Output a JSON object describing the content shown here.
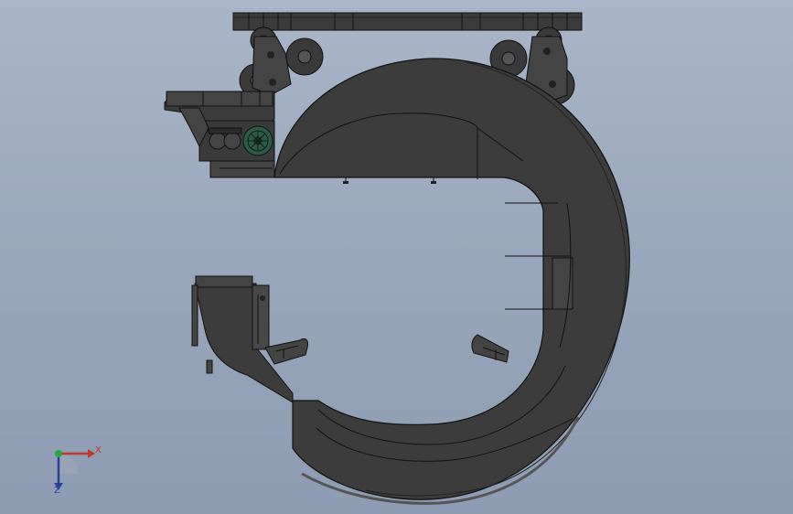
{
  "viewport": {
    "background_top": "#aab5c8",
    "background_bottom": "#8e9cb3"
  },
  "model": {
    "shade_color": "#3a3a3a",
    "edge_color": "#151515",
    "highlight_color": "#4a4a4a",
    "motor_color": "#2f5a48"
  },
  "triad": {
    "x_label": "X",
    "z_label": "Z",
    "x_color": "#c0392b",
    "z_color": "#2c3e9c",
    "y_color": "#27a844"
  }
}
